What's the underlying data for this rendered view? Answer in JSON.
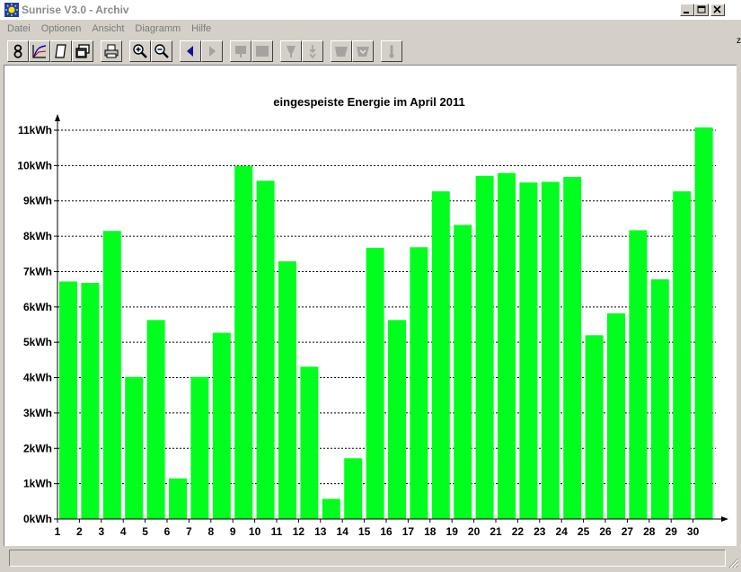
{
  "window": {
    "title": "Sunrise V3.0 - Archiv",
    "side_glyph": "z"
  },
  "menu": {
    "items": [
      "Datei",
      "Optionen",
      "Ansicht",
      "Diagramm",
      "Hilfe"
    ]
  },
  "toolbar": {
    "buttons": [
      {
        "icon": "eight-icon"
      },
      {
        "icon": "line-chart-icon"
      },
      {
        "icon": "page-icon"
      },
      {
        "icon": "copy-window-icon"
      },
      {
        "icon": "printer-icon"
      },
      {
        "icon": "zoom-in-icon"
      },
      {
        "icon": "zoom-out-icon"
      },
      {
        "icon": "arrow-left-icon"
      },
      {
        "icon": "arrow-right-icon"
      },
      {
        "icon": "box-down-icon"
      },
      {
        "icon": "box-icon"
      },
      {
        "icon": "plug-icon"
      },
      {
        "icon": "plug-arrow-icon"
      },
      {
        "icon": "folder-icon"
      },
      {
        "icon": "folder-down-icon"
      },
      {
        "icon": "thermometer-icon"
      }
    ]
  },
  "colors": {
    "bar": "#00ff1e",
    "grid": "#000000"
  },
  "chart_data": {
    "type": "bar",
    "title": "eingespeiste Energie im April 2011",
    "categories": [
      "1",
      "2",
      "3",
      "4",
      "5",
      "6",
      "7",
      "8",
      "9",
      "10",
      "11",
      "12",
      "13",
      "14",
      "15",
      "16",
      "17",
      "18",
      "19",
      "20",
      "21",
      "22",
      "23",
      "24",
      "25",
      "26",
      "27",
      "28",
      "29",
      "30"
    ],
    "values": [
      6.72,
      6.68,
      8.15,
      4.02,
      5.63,
      1.15,
      4.02,
      5.27,
      9.99,
      9.57,
      7.29,
      4.31,
      0.57,
      1.72,
      7.67,
      5.63,
      7.69,
      9.27,
      8.32,
      9.71,
      9.79,
      9.52,
      9.54,
      9.68,
      5.2,
      5.82,
      8.17,
      6.78,
      9.27,
      11.08
    ],
    "y_ticks": [
      "0kWh",
      "1kWh",
      "2kWh",
      "3kWh",
      "4kWh",
      "5kWh",
      "6kWh",
      "7kWh",
      "8kWh",
      "9kWh",
      "10kWh",
      "11kWh"
    ],
    "ylim": [
      0,
      11
    ],
    "grid": true,
    "legend": "none"
  }
}
